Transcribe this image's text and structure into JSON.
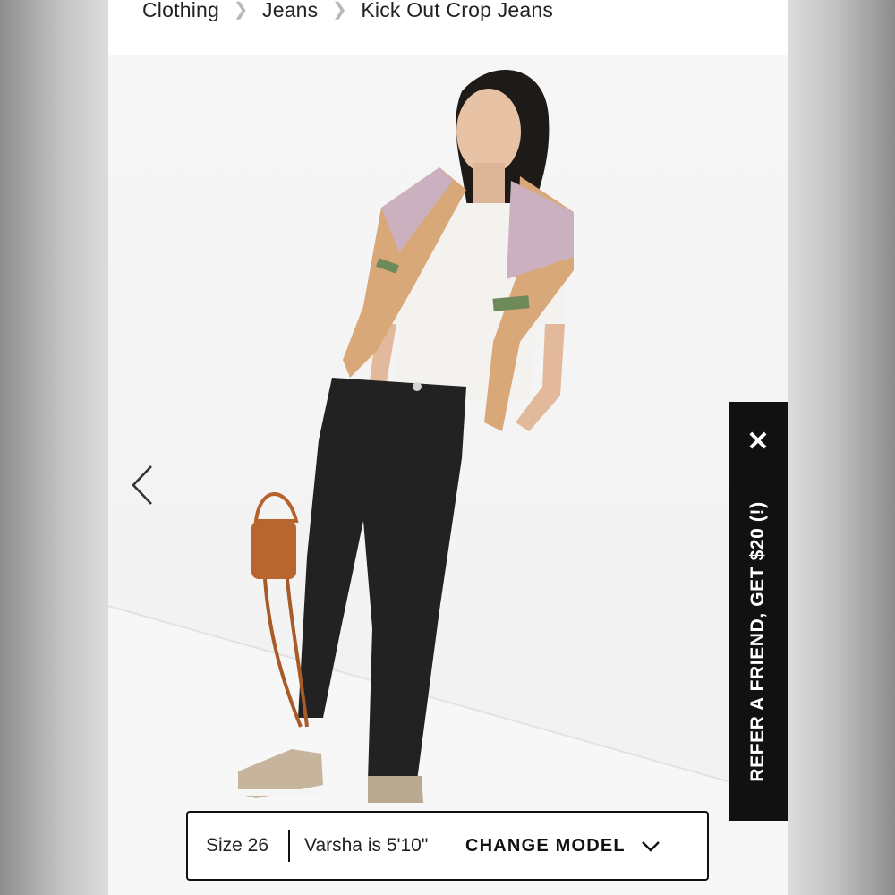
{
  "breadcrumb": {
    "items": [
      "Clothing",
      "Jeans",
      "Kick Out Crop Jeans"
    ]
  },
  "gallery": {
    "prev_icon": "chevron-left-icon"
  },
  "refer_banner": {
    "text": "REFER A FRIEND, GET $20 (!)",
    "close_symbol": "✕",
    "background": "#111111"
  },
  "model_bar": {
    "size_text": "Size 26",
    "model_text": "Varsha is 5'10\"",
    "change_label": "CHANGE MODEL",
    "dropdown_icon": "chevron-down-icon"
  }
}
